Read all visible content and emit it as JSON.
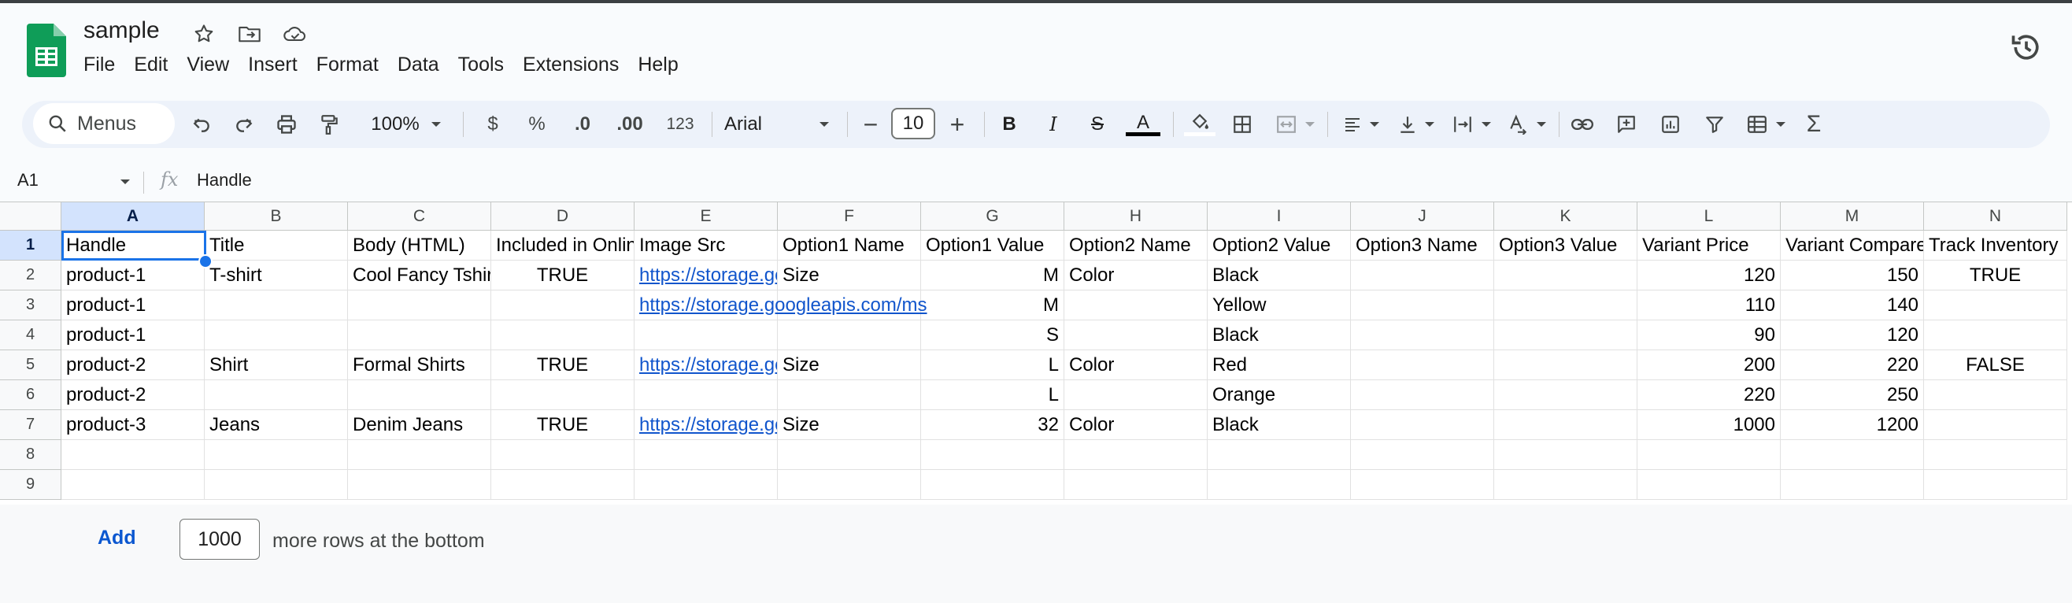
{
  "doc": {
    "title": "sample"
  },
  "menu": [
    "File",
    "Edit",
    "View",
    "Insert",
    "Format",
    "Data",
    "Tools",
    "Extensions",
    "Help"
  ],
  "toolbar": {
    "search_label": "Menus",
    "zoom": "100%",
    "currency": "$",
    "percent": "%",
    "dec_decrease": ".0",
    "dec_increase": ".00",
    "number_format": "123",
    "font": "Arial",
    "font_size": "10",
    "minus": "−",
    "plus": "+",
    "bold": "B",
    "italic": "I",
    "strike": "S",
    "text_color": "A"
  },
  "formula_bar": {
    "cell_ref": "A1",
    "fx": "fx",
    "value": "Handle"
  },
  "grid": {
    "columns": [
      "A",
      "B",
      "C",
      "D",
      "E",
      "F",
      "G",
      "H",
      "I",
      "J",
      "K",
      "L",
      "M",
      "N"
    ],
    "rows": [
      "1",
      "2",
      "3",
      "4",
      "5",
      "6",
      "7",
      "8",
      "9"
    ],
    "cells": [
      [
        "Handle",
        "Title",
        "Body (HTML)",
        "Included in Onlin",
        "Image Src",
        "Option1 Name",
        "Option1 Value",
        "Option2 Name",
        "Option2 Value",
        "Option3 Name",
        "Option3 Value",
        "Variant Price",
        "Variant Compare",
        "Track Inventory"
      ],
      [
        "product-1",
        "T-shirt",
        "Cool Fancy Tshir",
        "TRUE",
        "https://storage.go",
        "Size",
        "M",
        "Color",
        "Black",
        "",
        "",
        "120",
        "150",
        "TRUE"
      ],
      [
        "product-1",
        "",
        "",
        "",
        "https://storage.googleapis.com/ms",
        "",
        "M",
        "",
        "Yellow",
        "",
        "",
        "110",
        "140",
        ""
      ],
      [
        "product-1",
        "",
        "",
        "",
        "",
        "",
        "S",
        "",
        "Black",
        "",
        "",
        "90",
        "120",
        ""
      ],
      [
        "product-2",
        "Shirt",
        "Formal Shirts",
        "TRUE",
        "https://storage.go",
        "Size",
        "L",
        "Color",
        "Red",
        "",
        "",
        "200",
        "220",
        "FALSE"
      ],
      [
        "product-2",
        "",
        "",
        "",
        "",
        "",
        "L",
        "",
        "Orange",
        "",
        "",
        "220",
        "250",
        ""
      ],
      [
        "product-3",
        "Jeans",
        "Denim Jeans",
        "TRUE",
        "https://storage.go",
        "Size",
        "32",
        "Color",
        "Black",
        "",
        "",
        "1000",
        "1200",
        ""
      ],
      [
        "",
        "",
        "",
        "",
        "",
        "",
        "",
        "",
        "",
        "",
        "",
        "",
        "",
        ""
      ],
      [
        "",
        "",
        "",
        "",
        "",
        "",
        "",
        "",
        "",
        "",
        "",
        "",
        "",
        ""
      ]
    ]
  },
  "footer": {
    "add_label": "Add",
    "rows_value": "1000",
    "rows_text": "more rows at the bottom"
  },
  "colors": {
    "accent": "#1a73e8",
    "link": "#1155cc",
    "sheets_green": "#0f9d58",
    "toolbar_bg": "#edf2fa"
  }
}
